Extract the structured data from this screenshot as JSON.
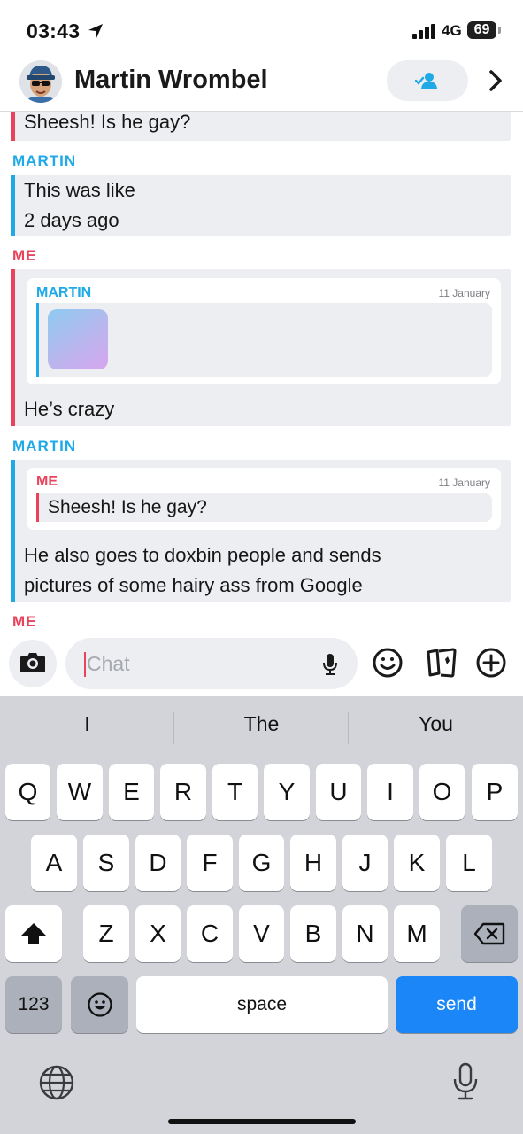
{
  "status_bar": {
    "time": "03:43",
    "network": "4G",
    "battery": "69"
  },
  "header": {
    "contact_name": "Martin Wrombel"
  },
  "messages": {
    "m1_text": "Sheesh! Is he gay?",
    "m2_sender": "MARTIN",
    "m2_line1": "This was like",
    "m2_line2": "2 days ago",
    "m3_sender": "ME",
    "m3_quote_sender": "MARTIN",
    "m3_quote_date": "11 January",
    "m3_text": "He’s crazy",
    "m4_sender": "MARTIN",
    "m4_quote_sender": "ME",
    "m4_quote_date": "11 January",
    "m4_quote_text": "Sheesh! Is he gay?",
    "m4_line1": "He also goes to doxbin people and sends",
    "m4_line2": "pictures of some hairy ass from Google",
    "m5_sender": "ME"
  },
  "input": {
    "placeholder": "Chat"
  },
  "keyboard": {
    "suggestions": [
      "I",
      "The",
      "You"
    ],
    "row1": [
      "Q",
      "W",
      "E",
      "R",
      "T",
      "Y",
      "U",
      "I",
      "O",
      "P"
    ],
    "row2": [
      "A",
      "S",
      "D",
      "F",
      "G",
      "H",
      "J",
      "K",
      "L"
    ],
    "row3": [
      "Z",
      "X",
      "C",
      "V",
      "B",
      "N",
      "M"
    ],
    "numbers_label": "123",
    "space_label": "space",
    "send_label": "send"
  },
  "colors": {
    "me": "#e8435a",
    "friend": "#1fa9e6",
    "send_key": "#1a86f7"
  },
  "icons": [
    "location-arrow-icon",
    "signal-icon",
    "add-friend-icon",
    "chevron-right-icon",
    "camera-icon",
    "mic-icon",
    "emoji-icon",
    "cards-icon",
    "plus-icon",
    "shift-icon",
    "backspace-icon",
    "emoji-key-icon",
    "globe-icon",
    "dictation-icon"
  ]
}
